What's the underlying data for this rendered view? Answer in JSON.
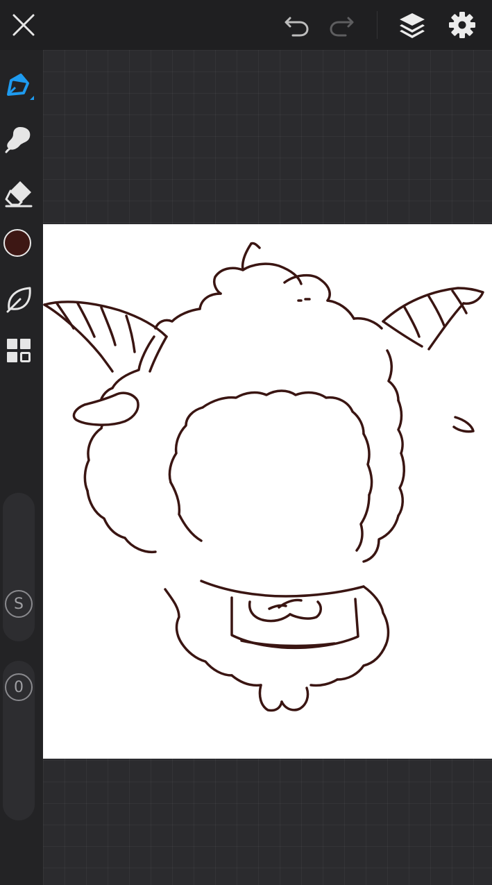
{
  "toolbar": {
    "close_icon": "close-icon",
    "undo_icon": "undo-icon",
    "redo_icon": "redo-icon",
    "layers_icon": "layers-icon",
    "settings_icon": "gear-icon"
  },
  "tools": [
    {
      "name": "pen",
      "icon": "pen-icon",
      "active": true
    },
    {
      "name": "smudge",
      "icon": "smudge-icon"
    },
    {
      "name": "eraser",
      "icon": "eraser-icon"
    },
    {
      "name": "color",
      "icon": "color-swatch"
    },
    {
      "name": "stabilizer",
      "icon": "leaf-icon"
    },
    {
      "name": "gallery",
      "icon": "grid-icon"
    }
  ],
  "colors": {
    "accent": "#1e9bf0",
    "current_brush": "#3d1714",
    "ink": "#3a1512",
    "toolbar_bg": "#1f1f21",
    "workspace_bg": "#2b2b2e"
  },
  "sliders": {
    "size_label": "S",
    "opacity_label": "0"
  }
}
